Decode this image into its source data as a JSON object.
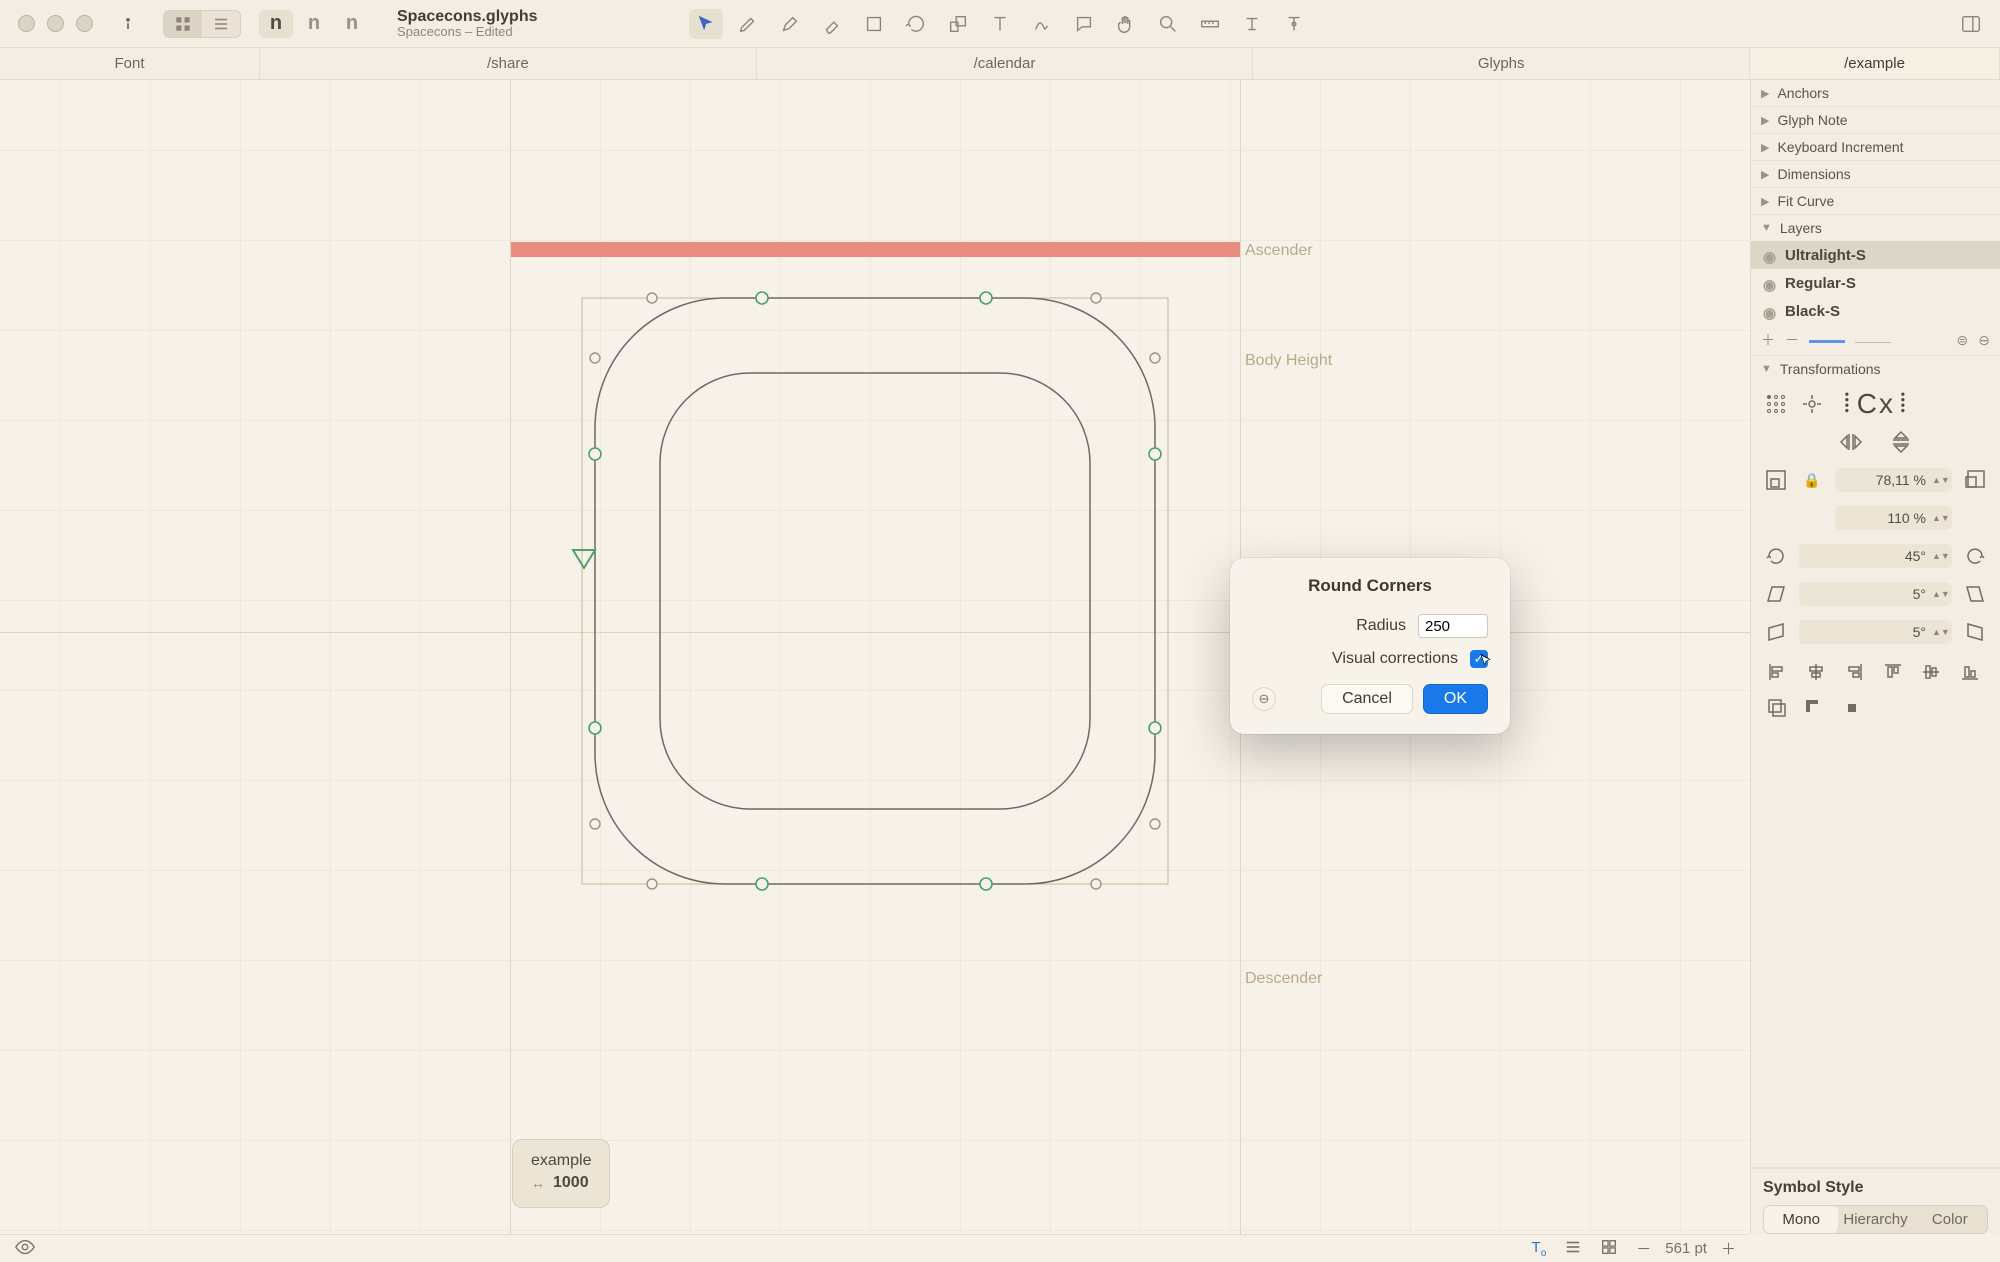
{
  "titlebar": {
    "filename": "Spacecons.glyphs",
    "subtitle": "Spacecons – Edited",
    "n_buttons": [
      "n",
      "n",
      "n"
    ]
  },
  "tabs": [
    {
      "label": "Font"
    },
    {
      "label": "/share"
    },
    {
      "label": "/calendar"
    },
    {
      "label": "Glyphs"
    },
    {
      "label": "/example",
      "active": true
    }
  ],
  "canvas": {
    "ascender_label": "Ascender",
    "body_label": "Body Height",
    "descender_label": "Descender",
    "info_name": "example",
    "info_width": "1000"
  },
  "dialog": {
    "title": "Round Corners",
    "radius_label": "Radius",
    "radius_value": "250",
    "visual_label": "Visual corrections",
    "visual_checked": true,
    "cancel": "Cancel",
    "ok": "OK"
  },
  "sidebar": {
    "sections": {
      "anchors": "Anchors",
      "glyph_note": "Glyph Note",
      "keyboard_inc": "Keyboard Increment",
      "dimensions": "Dimensions",
      "fit_curve": "Fit Curve",
      "layers": "Layers",
      "transformations": "Transformations"
    },
    "layers": [
      {
        "name": "Ultralight-S",
        "selected": true
      },
      {
        "name": "Regular-S"
      },
      {
        "name": "Black-S"
      }
    ],
    "transform": {
      "scale": "78,11 %",
      "scale2": "110 %",
      "rotate": "45°",
      "slant1": "5°",
      "slant2": "5°",
      "cx_label": "Cx"
    },
    "symbol_style": {
      "title": "Symbol Style",
      "segments": [
        "Mono",
        "Hierarchy",
        "Color"
      ],
      "active": 0
    }
  },
  "statusbar": {
    "zoom": "561 pt"
  }
}
